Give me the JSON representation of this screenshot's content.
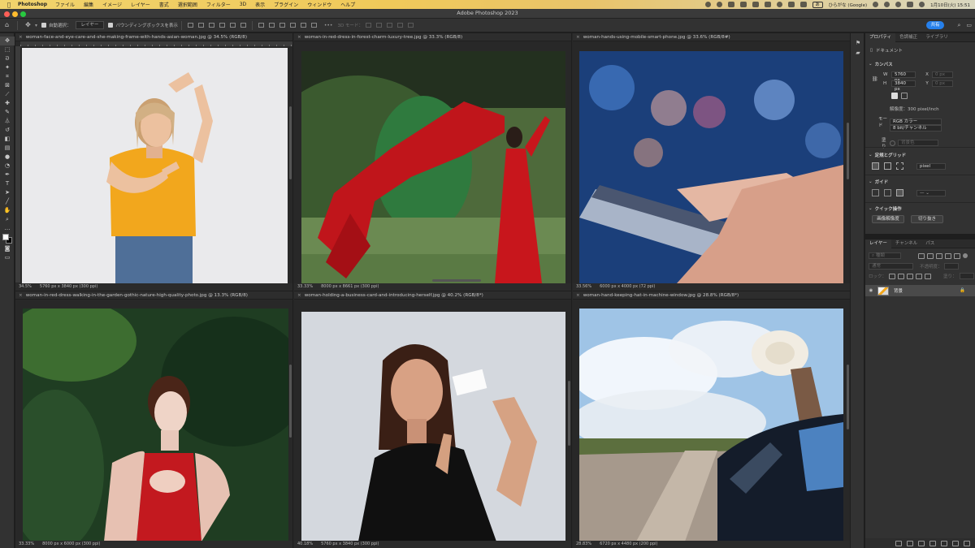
{
  "menubar": {
    "app": "Photoshop",
    "items": [
      "ファイル",
      "編集",
      "イメージ",
      "レイヤー",
      "書式",
      "選択範囲",
      "フィルター",
      "3D",
      "表示",
      "プラグイン",
      "ウィンドウ",
      "ヘルプ"
    ],
    "input_method": "ひらがな (Google)",
    "datetime": "1月10日(火) 15:51"
  },
  "window": {
    "title": "Adobe Photoshop 2023"
  },
  "options": {
    "auto_select_label": "自動選択：",
    "auto_select_value": "レイヤー",
    "show_bbox_label": "バウンディングボックスを表示",
    "mode_3d_label": "3D モード：",
    "share_label": "共有"
  },
  "documents": [
    {
      "tab": "woman-face-and-eye-care-and-she-making-frame-with-hands-asian-woman.jpg @ 34.5% (RGB/8)",
      "zoom": "34.5%",
      "info": "5760 px x 3840 px (300 ppi)"
    },
    {
      "tab": "woman-in-red-dress-in-forest-charm-luxury-tree.jpg @ 33.3% (RGB/8)",
      "zoom": "33.33%",
      "info": "8000 px x 8661 px (300 ppi)"
    },
    {
      "tab": "woman-hands-using-mobile-smart-phone.jpg @ 33.6% (RGB/8#)",
      "zoom": "33.56%",
      "info": "6000 px x 4000 px (72 ppi)"
    },
    {
      "tab": "woman-in-red-dress-walking-in-the-garden-gothic-nature-high-quality-photo.jpg @ 13.3% (RGB/8)",
      "zoom": "33.33%",
      "info": "8000 px x 6000 px (300 ppi)"
    },
    {
      "tab": "woman-holding-a-business-card-and-introducing-herself.jpg @ 40.2% (RGB/8*)",
      "zoom": "40.18%",
      "info": "5760 px x 3840 px (300 ppi)"
    },
    {
      "tab": "woman-hand-keeping-hat-in-machine-window.jpg @ 28.8% (RGB/8*)",
      "zoom": "28.83%",
      "info": "6720 px x 4480 px (200 ppi)"
    }
  ],
  "properties": {
    "tabs": [
      "プロパティ",
      "色調補正",
      "ライブラリ"
    ],
    "doc_label": "ドキュメント",
    "canvas_title": "カンバス",
    "w_label": "W",
    "w_value": "5760 px",
    "h_label": "H",
    "h_value": "3840 px",
    "x_label": "X",
    "x_placeholder": "0 px",
    "y_label": "Y",
    "y_placeholder": "0 px",
    "resolution": "解像度：300 pixel/inch",
    "mode_label": "モード",
    "mode_value": "RGB カラー",
    "bits_value": "8 bit/チャンネル",
    "fill_label": "塗り",
    "fill_placeholder": "背景色",
    "rulers_title": "定規とグリッド",
    "unit_value": "pixel",
    "guides_title": "ガイド",
    "quick_title": "クイック操作",
    "quick_btn1": "画像解像度",
    "quick_btn2": "切り抜き"
  },
  "layers": {
    "tabs": [
      "レイヤー",
      "チャンネル",
      "パス"
    ],
    "search_placeholder": "種類",
    "blend": "通常",
    "opacity_label": "不透明度：",
    "lock_label": "ロック：",
    "fill_label": "塗り：",
    "layer_name": "背景"
  }
}
